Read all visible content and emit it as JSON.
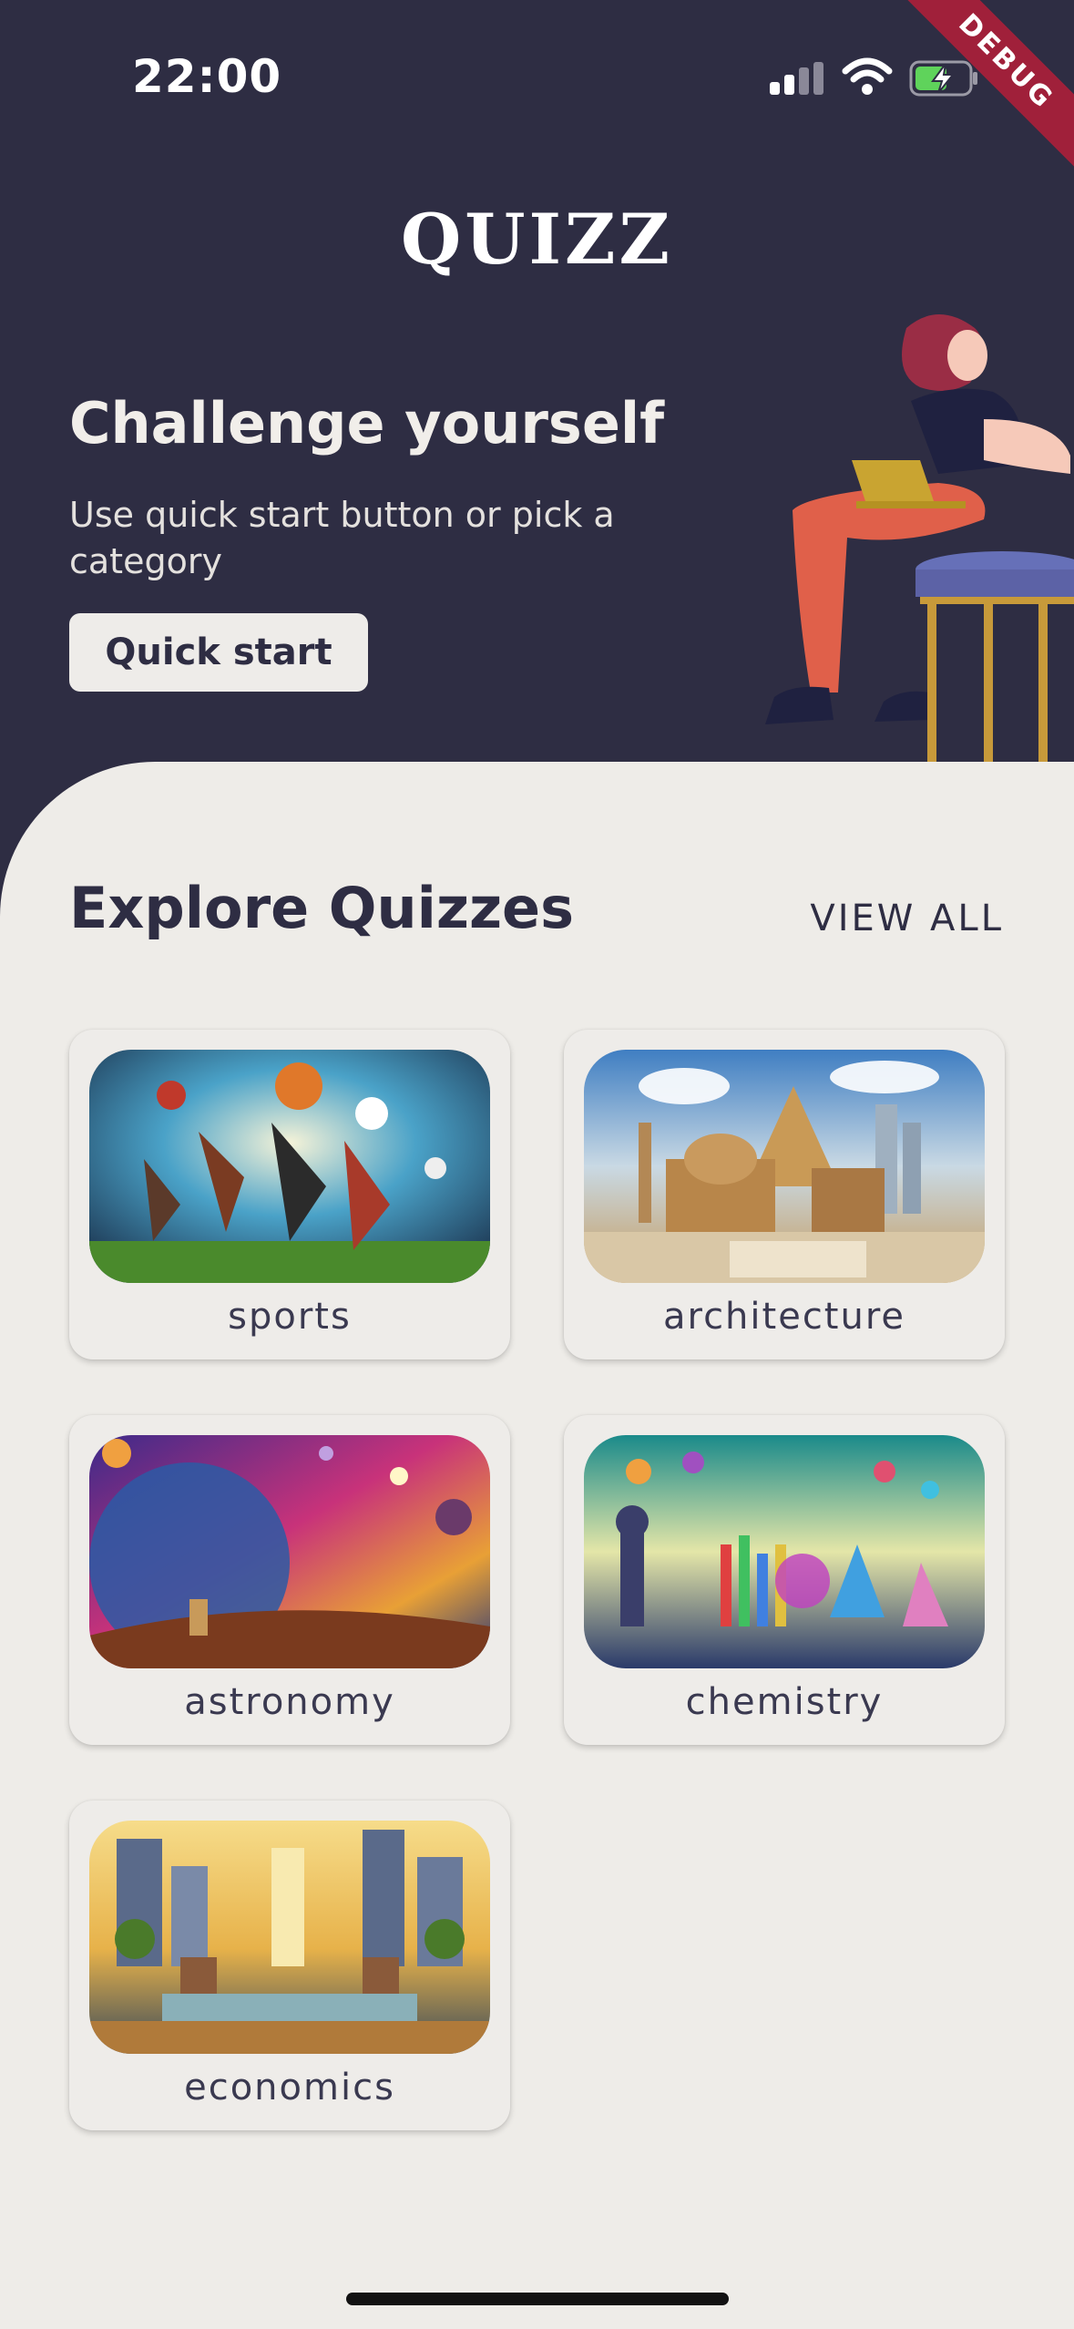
{
  "status_bar": {
    "time": "22:00",
    "icons": [
      "cellular-signal-icon",
      "wifi-icon",
      "battery-charging-icon"
    ]
  },
  "debug_banner": "DEBUG",
  "app": {
    "logo": "QUIZZ"
  },
  "hero": {
    "title": "Challenge yourself",
    "subtitle": "Use quick start button or pick a category",
    "quick_start_label": "Quick start"
  },
  "explore": {
    "title": "Explore Quizzes",
    "view_all_label": "VIEW ALL",
    "categories": [
      {
        "label": "sports"
      },
      {
        "label": "architecture"
      },
      {
        "label": "astronomy"
      },
      {
        "label": "chemistry"
      },
      {
        "label": "economics"
      }
    ]
  },
  "colors": {
    "header_background": "#2e2d43",
    "sheet_background": "#eeece8",
    "accent_text": "#2e2d43",
    "debug_ribbon": "#a0203a"
  }
}
